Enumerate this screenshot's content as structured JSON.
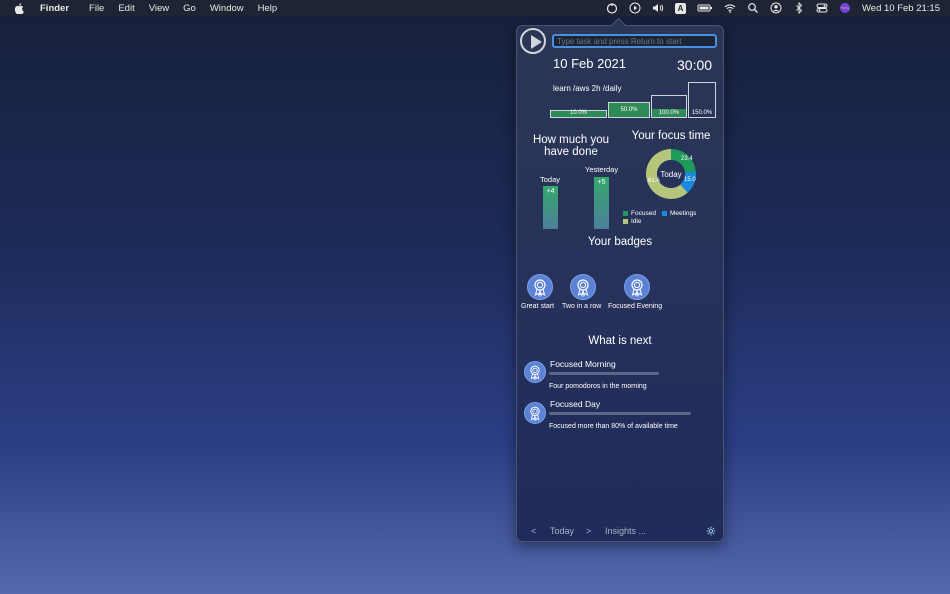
{
  "menubar": {
    "app_name": "Finder",
    "menus": [
      "File",
      "Edit",
      "View",
      "Go",
      "Window",
      "Help"
    ],
    "input_indicator": "A",
    "clock": "Wed 10 Feb  21:15"
  },
  "panel": {
    "task_placeholder": "Type task and press Return to start",
    "date": "10 Feb 2021",
    "timer": "30:00",
    "goal": "learn /aws 2h /daily",
    "goal_bars": [
      {
        "label": "10.0%",
        "fill": 0.1
      },
      {
        "label": "50.0%",
        "fill": 0.5
      },
      {
        "label": "100.0%",
        "fill": 1.0
      },
      {
        "label": "150.0%",
        "fill": 1.5
      }
    ],
    "done_title": "How much you have done",
    "done": [
      {
        "label": "Today",
        "value": "+4"
      },
      {
        "label": "Yesterday",
        "value": "+5"
      }
    ],
    "focus_title": "Your focus time",
    "donut_center": "Today",
    "donut": [
      {
        "name": "Focused",
        "value": 23.4,
        "color": "#1e9a5a"
      },
      {
        "name": "Meetings",
        "value": 15.0,
        "color": "#1a8ae0"
      },
      {
        "name": "Idle",
        "value": 61.6,
        "color": "#b5c57a"
      }
    ],
    "donut_labels": [
      "23.4",
      "15.0",
      "61.6"
    ],
    "legend": [
      "Focused",
      "Meetings",
      "Idle"
    ],
    "badges_title": "Your badges",
    "badges": [
      "Great start",
      "Two in a row",
      "Focused Evening"
    ],
    "next_title": "What is next",
    "next": [
      {
        "title": "Focused Morning",
        "desc": "Four pomodoros in the morning"
      },
      {
        "title": "Focused Day",
        "desc": "Focused more than 80% of available time"
      }
    ],
    "footer": {
      "prev": "<",
      "today": "Today",
      "next": ">",
      "insights": "Insights ..."
    }
  }
}
